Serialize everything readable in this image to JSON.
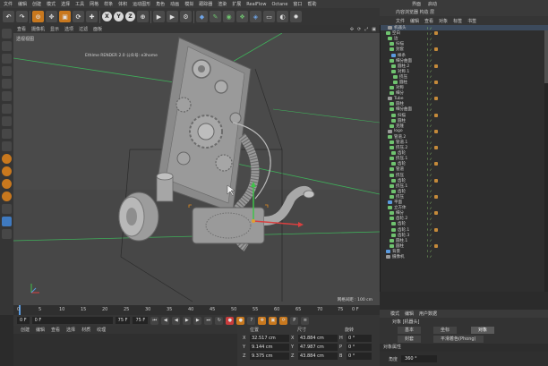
{
  "menubar": {
    "items": [
      "文件",
      "编辑",
      "创建",
      "模式",
      "选择",
      "工具",
      "网格",
      "样条",
      "体积",
      "运动图形",
      "角色",
      "动画",
      "模拟",
      "跟踪器",
      "渲染",
      "扩展",
      "RealFlow",
      "Octane",
      "窗口",
      "帮助"
    ],
    "right": [
      "界面",
      "启动"
    ]
  },
  "toolbar": {
    "axis_x": "X",
    "axis_y": "Y",
    "axis_z": "Z"
  },
  "viewport": {
    "menu": [
      "查看",
      "摄像机",
      "显示",
      "选项",
      "过滤",
      "面板"
    ],
    "label": "透视视图",
    "hud": "Ethlme RENDER 2.0  公众号: e3home",
    "grid_spacing": "网格间距 : 100 cm",
    "vp_icons": [
      "✣",
      "⟳",
      "⤢",
      "▣"
    ]
  },
  "timeline": {
    "ticks": [
      "0",
      "5",
      "10",
      "15",
      "20",
      "25",
      "30",
      "35",
      "40",
      "45",
      "50",
      "55",
      "60",
      "65",
      "70",
      "75"
    ],
    "end_label": "0 F"
  },
  "transport": {
    "start": "0 F",
    "current": "0 F",
    "end": "75 F",
    "end2": "75 F"
  },
  "anim_menu": [
    "创建",
    "编辑",
    "查看",
    "选择",
    "材质",
    "纹理"
  ],
  "coordinates": {
    "headers": [
      "位置",
      "尺寸",
      "旋转"
    ],
    "rows": [
      {
        "axis": "X",
        "pos": "32.517 cm",
        "size": "43.884 cm",
        "rotlabel": "H",
        "rot": "0 °"
      },
      {
        "axis": "Y",
        "pos": "9.144 cm",
        "size": "47.987 cm",
        "rotlabel": "P",
        "rot": "0 °"
      },
      {
        "axis": "Z",
        "pos": "9.375 cm",
        "size": "43.884 cm",
        "rotlabel": "B",
        "rot": "0 °"
      }
    ]
  },
  "right_panel": {
    "tabs_top": "内容浏览器   构造   层",
    "menu1": [
      "文件",
      "编辑",
      "查看",
      "对象",
      "标签",
      "书签"
    ],
    "objects": [
      {
        "name": "机器头",
        "icon": "n",
        "sel": true
      },
      {
        "name": "空白",
        "icon": "g"
      },
      {
        "name": "边",
        "icon": "g"
      },
      {
        "name": "扫描",
        "icon": "g"
      },
      {
        "name": "封套",
        "icon": "g"
      },
      {
        "name": "样条",
        "icon": "b"
      },
      {
        "name": "细分曲面",
        "icon": "g"
      },
      {
        "name": "圆柱.2",
        "icon": "g"
      },
      {
        "name": "对称.1",
        "icon": "g"
      },
      {
        "name": "挤压",
        "icon": "g"
      },
      {
        "name": "圆柱",
        "icon": "g"
      },
      {
        "name": "对称",
        "icon": "g"
      },
      {
        "name": "细分",
        "icon": "g"
      },
      {
        "name": "Tube",
        "icon": "n"
      },
      {
        "name": "圆柱",
        "icon": "g"
      },
      {
        "name": "细分曲面",
        "icon": "g"
      },
      {
        "name": "扫描",
        "icon": "g"
      },
      {
        "name": "圆柱",
        "icon": "g"
      },
      {
        "name": "克隆",
        "icon": "g"
      },
      {
        "name": "logo",
        "icon": "n"
      },
      {
        "name": "管道.2",
        "icon": "g"
      },
      {
        "name": "管道.1",
        "icon": "g"
      },
      {
        "name": "挤压.2",
        "icon": "g"
      },
      {
        "name": "齿轮",
        "icon": "g"
      },
      {
        "name": "挤压.1",
        "icon": "g"
      },
      {
        "name": "齿轮",
        "icon": "g"
      },
      {
        "name": "管道",
        "icon": "g"
      },
      {
        "name": "挤压",
        "icon": "g"
      },
      {
        "name": "齿轮",
        "icon": "g"
      },
      {
        "name": "挤压.1",
        "icon": "g"
      },
      {
        "name": "齿轮",
        "icon": "g"
      },
      {
        "name": "挤压",
        "icon": "g"
      },
      {
        "name": "平面",
        "icon": "b"
      },
      {
        "name": "立方体",
        "icon": "g"
      },
      {
        "name": "细分",
        "icon": "g"
      },
      {
        "name": "齿轮.2",
        "icon": "g"
      },
      {
        "name": "齿轮",
        "icon": "g"
      },
      {
        "name": "齿轮.1",
        "icon": "g"
      },
      {
        "name": "齿轮.3",
        "icon": "g"
      },
      {
        "name": "圆柱.1",
        "icon": "g"
      },
      {
        "name": "圆柱",
        "icon": "g"
      },
      {
        "name": "背景",
        "icon": "b"
      },
      {
        "name": "摄像机",
        "icon": "n"
      }
    ]
  },
  "attributes": {
    "menu": [
      "模式",
      "编辑",
      "用户数据"
    ],
    "title": "对象 [机器头]",
    "tabs": [
      "基本",
      "坐标",
      "对象",
      "封套",
      "平滑着色(Phong)"
    ],
    "section": "对象属性",
    "row_label": "角度",
    "row_value": "360 °"
  }
}
